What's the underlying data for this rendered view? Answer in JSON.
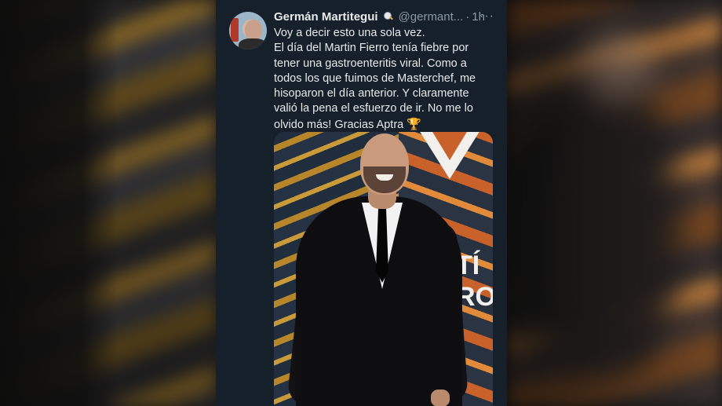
{
  "tweet": {
    "author_name": "Germán Martitegui",
    "handle": "@germant...",
    "separator": "·",
    "time": "1h",
    "more_label": "···",
    "lines": [
      "Voy a decir esto una sola vez.",
      "El día del Martin Fierro tenía fiebre por",
      "tener una gastroenteritis viral. Como a",
      "todos los que fuimos de Masterchef, me",
      "hisoparon el día anterior. Y claramente",
      "valió la pena el esfuerzo de ir. No me lo",
      "olvido más! Gracias Aptra"
    ],
    "trophy": "🏆",
    "photo_sign": [
      "TÍ",
      "RO"
    ]
  },
  "colors": {
    "tweet_bg": "#15202b",
    "text": "#e7e9ea",
    "muted": "#8b98a5"
  },
  "icons": {
    "verified": "magnifier-badge-icon",
    "more": "more-options-icon",
    "trophy": "trophy-icon"
  }
}
